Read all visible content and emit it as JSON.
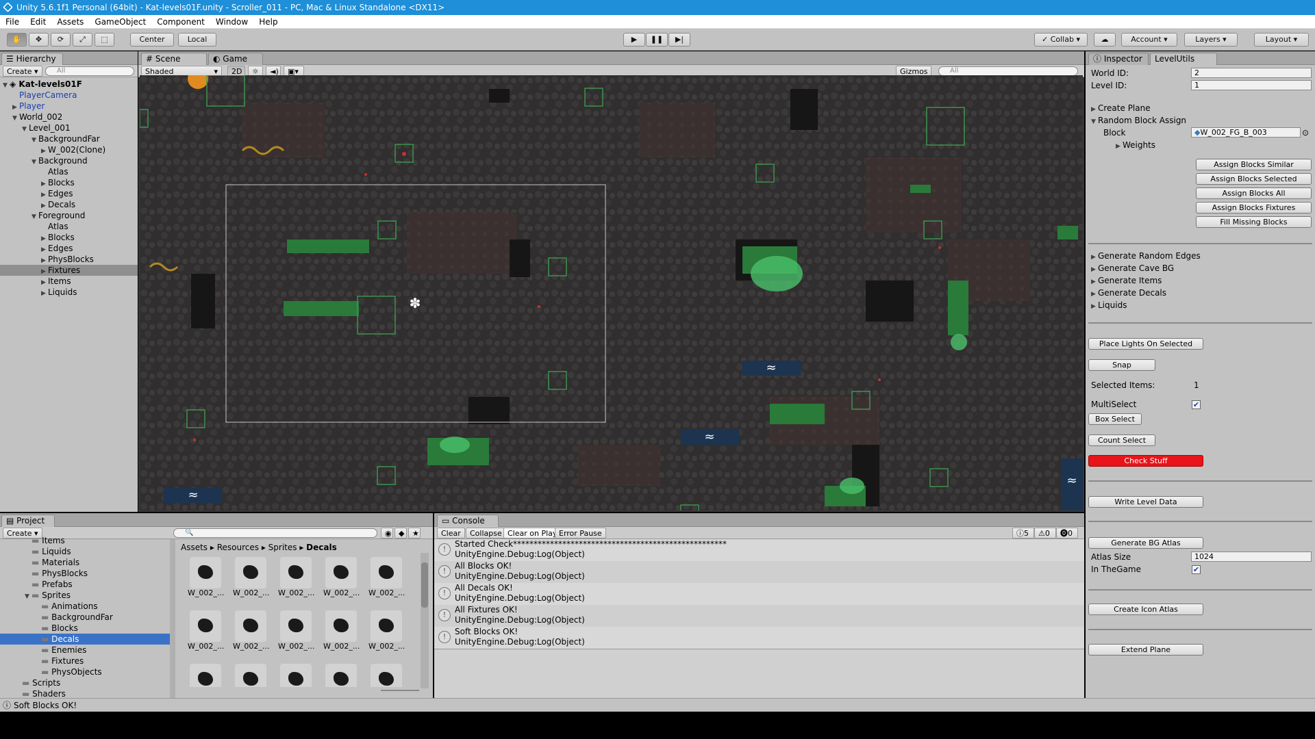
{
  "window": {
    "title": "Unity 5.6.1f1 Personal (64bit) - Kat-levels01F.unity - Scroller_011 - PC, Mac & Linux Standalone <DX11>"
  },
  "menu": [
    "File",
    "Edit",
    "Assets",
    "GameObject",
    "Component",
    "Window",
    "Help"
  ],
  "toolbar": {
    "pivot": "Center",
    "space": "Local",
    "collab": "Collab",
    "account": "Account",
    "layers": "Layers",
    "layout": "Layout"
  },
  "hierarchy": {
    "tab": "Hierarchy",
    "create": "Create",
    "search_placeholder": "All",
    "scene": "Kat-levels01F",
    "items": [
      {
        "label": "PlayerCamera",
        "depth": 1,
        "arrow": "",
        "blue": true
      },
      {
        "label": "Player",
        "depth": 1,
        "arrow": "▶",
        "blue": true
      },
      {
        "label": "World_002",
        "depth": 1,
        "arrow": "▼",
        "blue": false
      },
      {
        "label": "Level_001",
        "depth": 2,
        "arrow": "▼",
        "blue": false
      },
      {
        "label": "BackgroundFar",
        "depth": 3,
        "arrow": "▼",
        "blue": false
      },
      {
        "label": "W_002(Clone)",
        "depth": 4,
        "arrow": "▶",
        "blue": false
      },
      {
        "label": "Background",
        "depth": 3,
        "arrow": "▼",
        "blue": false
      },
      {
        "label": "Atlas",
        "depth": 4,
        "arrow": "",
        "blue": false
      },
      {
        "label": "Blocks",
        "depth": 4,
        "arrow": "▶",
        "blue": false
      },
      {
        "label": "Edges",
        "depth": 4,
        "arrow": "▶",
        "blue": false
      },
      {
        "label": "Decals",
        "depth": 4,
        "arrow": "▶",
        "blue": false
      },
      {
        "label": "Foreground",
        "depth": 3,
        "arrow": "▼",
        "blue": false
      },
      {
        "label": "Atlas",
        "depth": 4,
        "arrow": "",
        "blue": false
      },
      {
        "label": "Blocks",
        "depth": 4,
        "arrow": "▶",
        "blue": false
      },
      {
        "label": "Edges",
        "depth": 4,
        "arrow": "▶",
        "blue": false
      },
      {
        "label": "PhysBlocks",
        "depth": 4,
        "arrow": "▶",
        "blue": false
      },
      {
        "label": "Fixtures",
        "depth": 4,
        "arrow": "▶",
        "blue": false,
        "selected": true
      },
      {
        "label": "Items",
        "depth": 4,
        "arrow": "▶",
        "blue": false
      },
      {
        "label": "Liquids",
        "depth": 4,
        "arrow": "▶",
        "blue": false
      }
    ]
  },
  "scene": {
    "tab_scene": "Scene",
    "tab_game": "Game",
    "shading": "Shaded",
    "mode2d": "2D",
    "gizmos": "Gizmos",
    "search_placeholder": "All"
  },
  "inspector": {
    "tab_inspector": "Inspector",
    "tab_levelutils": "LevelUtils",
    "world_id_label": "World ID:",
    "world_id": "2",
    "level_id_label": "Level ID:",
    "level_id": "1",
    "create_plane": "Create Plane",
    "random_block_assign": "Random Block Assign",
    "block_label": "Block",
    "block_value": "W_002_FG_B_003",
    "weights": "Weights",
    "assign_buttons": [
      "Assign Blocks Similar",
      "Assign Blocks Selected",
      "Assign Blocks All",
      "Assign Blocks Fixtures",
      "Fill Missing Blocks"
    ],
    "foldouts": [
      "Generate Random Edges",
      "Generate Cave BG",
      "Generate Items",
      "Generate Decals",
      "Liquids"
    ],
    "place_lights": "Place Lights On Selected",
    "snap": "Snap",
    "selected_items_label": "Selected Items:",
    "selected_items": "1",
    "multiselect": "MultiSelect",
    "box_select": "Box Select",
    "count_select": "Count Select",
    "check_stuff": "Check Stuff",
    "write_level_data": "Write Level Data",
    "generate_bg_atlas": "Generate BG Atlas",
    "atlas_size_label": "Atlas Size",
    "atlas_size": "1024",
    "in_the_game": "In TheGame",
    "create_icon_atlas": "Create Icon Atlas",
    "extend_plane": "Extend Plane",
    "accent_red": "#e8141a"
  },
  "project": {
    "tab": "Project",
    "create": "Create",
    "folders": [
      {
        "label": "Items",
        "depth": 2
      },
      {
        "label": "Liquids",
        "depth": 2
      },
      {
        "label": "Materials",
        "depth": 2
      },
      {
        "label": "PhysBlocks",
        "depth": 2
      },
      {
        "label": "Prefabs",
        "depth": 2
      },
      {
        "label": "Sprites",
        "depth": 2,
        "open": true
      },
      {
        "label": "Animations",
        "depth": 3
      },
      {
        "label": "BackgroundFar",
        "depth": 3
      },
      {
        "label": "Blocks",
        "depth": 3
      },
      {
        "label": "Decals",
        "depth": 3,
        "selected": true
      },
      {
        "label": "Enemies",
        "depth": 3
      },
      {
        "label": "Fixtures",
        "depth": 3
      },
      {
        "label": "PhysObjects",
        "depth": 3
      },
      {
        "label": "Scripts",
        "depth": 1
      },
      {
        "label": "Shaders",
        "depth": 1
      }
    ],
    "breadcrumb": [
      "Assets",
      "Resources",
      "Sprites",
      "Decals"
    ],
    "asset_label": "W_002_..."
  },
  "console": {
    "tab": "Console",
    "clear": "Clear",
    "collapse": "Collapse",
    "clear_on_play": "Clear on Play",
    "error_pause": "Error Pause",
    "count_log": "5",
    "count_warn": "0",
    "count_err": "0",
    "entries": [
      {
        "line1": "Started Check****************************************************",
        "line2": "UnityEngine.Debug:Log(Object)"
      },
      {
        "line1": "All Blocks OK!",
        "line2": "UnityEngine.Debug:Log(Object)"
      },
      {
        "line1": "All Decals OK!",
        "line2": "UnityEngine.Debug:Log(Object)"
      },
      {
        "line1": "All Fixtures OK!",
        "line2": "UnityEngine.Debug:Log(Object)"
      },
      {
        "line1": "Soft Blocks OK!",
        "line2": "UnityEngine.Debug:Log(Object)"
      }
    ]
  },
  "status": {
    "text": "Soft Blocks OK!"
  }
}
